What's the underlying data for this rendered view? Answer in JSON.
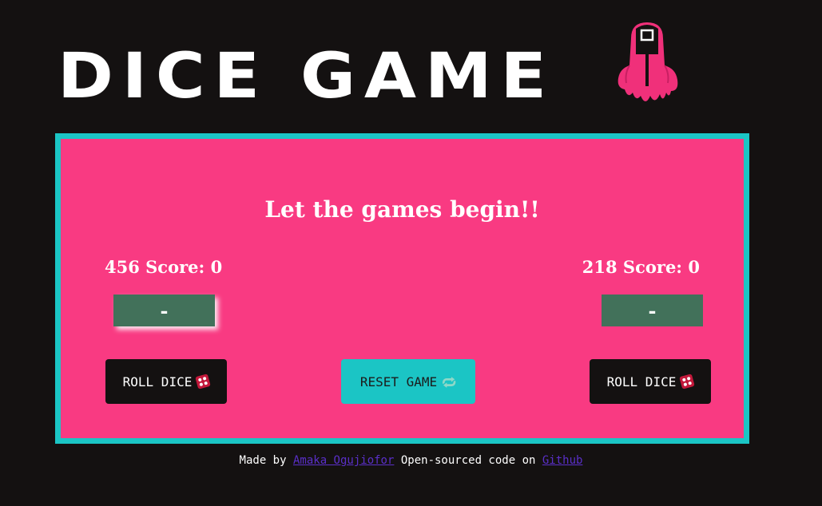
{
  "header": {
    "title_part1": "DICE",
    "title_part2": "GAME",
    "logo": "squid-game-guard-icon"
  },
  "board": {
    "headline": "Let the games begin!!",
    "players": [
      {
        "label": "456 Score: 0",
        "dice_value": "-",
        "roll_label": "ROLL DICE"
      },
      {
        "label": "218 Score: 0",
        "dice_value": "-",
        "roll_label": "ROLL DICE"
      }
    ],
    "reset_label": "RESET GAME"
  },
  "footer": {
    "made_by": "Made by",
    "author": "Amaka Ogujiofor",
    "middle": "Open-sourced code on",
    "repo": "Github"
  },
  "colors": {
    "background": "#141111",
    "board": "#f93a82",
    "border": "#1bc5c5",
    "dice_box": "#42715a",
    "link": "#5a2fc9"
  }
}
